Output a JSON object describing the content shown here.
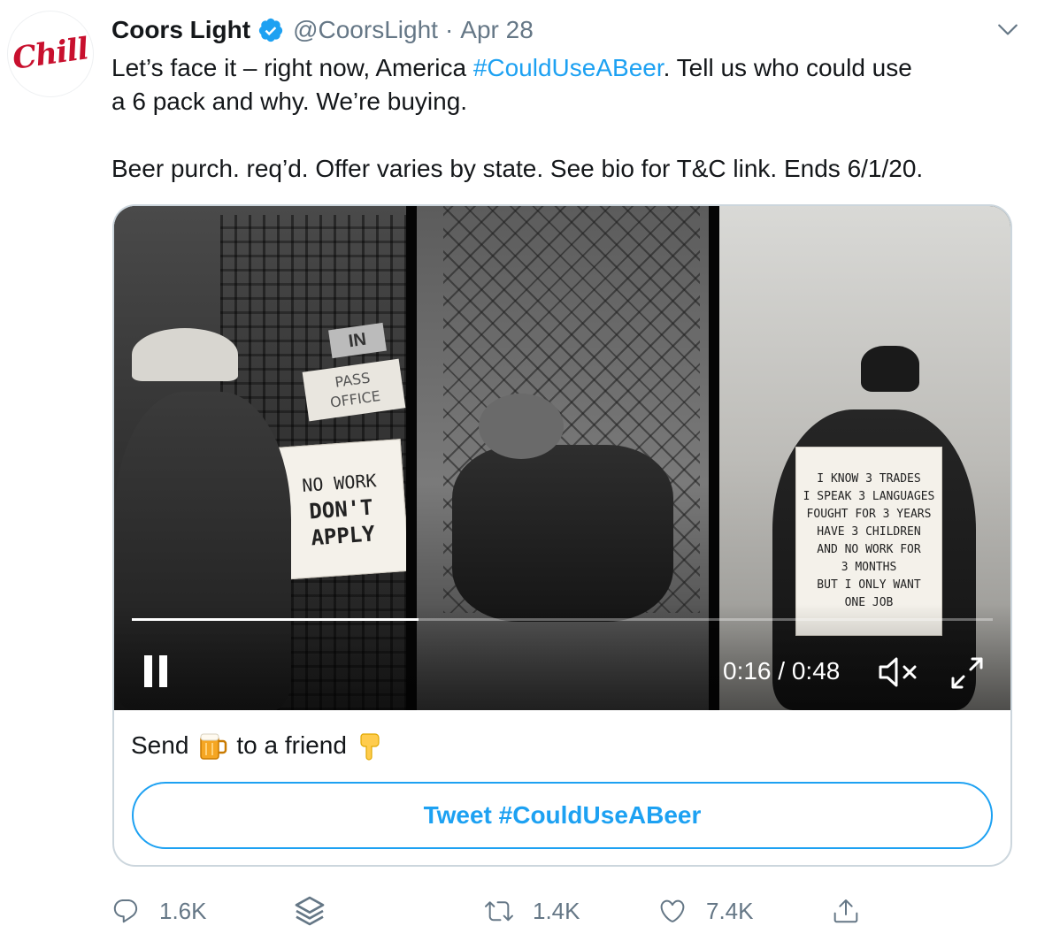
{
  "avatar": {
    "text": "Chill"
  },
  "tweet": {
    "display_name": "Coors Light",
    "handle": "@CoorsLight",
    "separator": "·",
    "date": "Apr 28",
    "line1_pre": "Let’s face it – right now, America ",
    "line1_hashtag": "#CouldUseABeer",
    "line1_post": ". Tell us who could use",
    "line2": "a 6 pack and why. We’re buying.",
    "line3": "Beer purch. req’d. Offer varies by state. See bio for T&C link. Ends 6/1/20."
  },
  "video": {
    "time_current": "0:16",
    "time_separator": " / ",
    "time_total": "0:48",
    "progress_fraction": 0.333,
    "sign_left": {
      "line1": "NO WORK",
      "line2": "DON'T APPLY"
    },
    "sign_pass": {
      "line1": "PASS",
      "line2": "OFFICE"
    },
    "sign_in": "IN",
    "sign_right": {
      "lines": [
        "I KNOW 3 TRADES",
        "I SPEAK 3 LANGUAGES",
        "FOUGHT FOR 3 YEARS",
        "HAVE 3 CHILDREN",
        "AND NO WORK FOR",
        "3 MONTHS",
        "BUT I ONLY WANT",
        "ONE JOB"
      ]
    }
  },
  "card": {
    "title_pre": "Send",
    "title_mid": "to a friend",
    "emoji_beer": "beer-mug-icon",
    "emoji_point": "pointing-down-icon",
    "cta_label": "Tweet #CouldUseABeer"
  },
  "actions": {
    "reply_count": "1.6K",
    "retweet_count": "1.4K",
    "like_count": "7.4K"
  },
  "colors": {
    "link": "#1da1f2",
    "secondary_text": "#657786",
    "primary_text": "#14171a",
    "border": "#ccd6dd",
    "brand_red": "#c8102e"
  }
}
